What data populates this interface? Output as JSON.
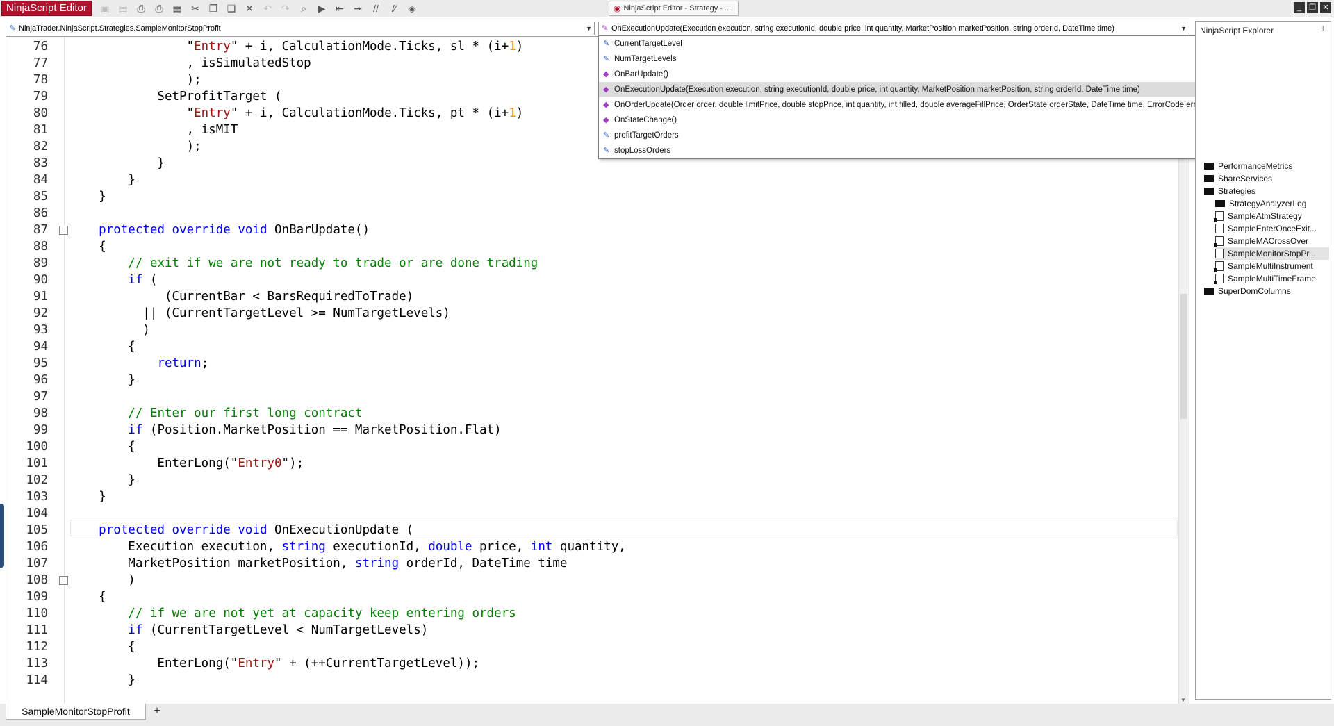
{
  "app": {
    "title": "NinjaScript Editor",
    "window_tab": "NinjaScript Editor - Strategy - ..."
  },
  "toolbar": [
    {
      "name": "save-icon",
      "glyph": "▣",
      "dim": true
    },
    {
      "name": "save-all-icon",
      "glyph": "▤",
      "dim": true
    },
    {
      "name": "print-icon",
      "glyph": "⎙",
      "dim": false
    },
    {
      "name": "print-preview-icon",
      "glyph": "⎙",
      "dim": false
    },
    {
      "name": "page-setup-icon",
      "glyph": "▦",
      "dim": false
    },
    {
      "name": "cut-icon",
      "glyph": "✂",
      "dim": false
    },
    {
      "name": "copy-icon",
      "glyph": "❐",
      "dim": false
    },
    {
      "name": "paste-icon",
      "glyph": "❏",
      "dim": false
    },
    {
      "name": "delete-icon",
      "glyph": "✕",
      "dim": false
    },
    {
      "name": "undo-icon",
      "glyph": "↶",
      "dim": true
    },
    {
      "name": "redo-icon",
      "glyph": "↷",
      "dim": true
    },
    {
      "name": "find-icon",
      "glyph": "⌕",
      "dim": false
    },
    {
      "name": "compile-icon",
      "glyph": "▶",
      "dim": false
    },
    {
      "name": "outdent-icon",
      "glyph": "⇤",
      "dim": false
    },
    {
      "name": "indent-icon",
      "glyph": "⇥",
      "dim": false
    },
    {
      "name": "comment-icon",
      "glyph": "//",
      "dim": false
    },
    {
      "name": "uncomment-icon",
      "glyph": "/⁄",
      "dim": false
    },
    {
      "name": "visual-studio-icon",
      "glyph": "◈",
      "dim": false
    }
  ],
  "class_dropdown": "NinjaTrader.NinjaScript.Strategies.SampleMonitorStopProfit",
  "member_dropdown": "OnExecutionUpdate(Execution execution, string executionId, double price, int quantity, MarketPosition marketPosition, string orderId, DateTime time)",
  "autocomplete": [
    {
      "label": "CurrentTargetLevel",
      "kind": "property",
      "selected": false
    },
    {
      "label": "NumTargetLevels",
      "kind": "property",
      "selected": false
    },
    {
      "label": "OnBarUpdate()",
      "kind": "method",
      "selected": false
    },
    {
      "label": "OnExecutionUpdate(Execution execution, string executionId, double price, int quantity, MarketPosition marketPosition, string orderId, DateTime time)",
      "kind": "method",
      "selected": true
    },
    {
      "label": "OnOrderUpdate(Order order, double limitPrice, double stopPrice, int quantity, int filled, double averageFillPrice, OrderState orderState, DateTime time, ErrorCode error, string nativeError)",
      "kind": "method",
      "selected": false
    },
    {
      "label": "OnStateChange()",
      "kind": "method",
      "selected": false
    },
    {
      "label": "profitTargetOrders",
      "kind": "property",
      "selected": false
    },
    {
      "label": "stopLossOrders",
      "kind": "property",
      "selected": false
    }
  ],
  "explorer": {
    "title": "NinjaScript Explorer",
    "items": [
      {
        "label": "PerformanceMetrics",
        "type": "folder",
        "indent": 0,
        "selected": false
      },
      {
        "label": "ShareServices",
        "type": "folder",
        "indent": 0,
        "selected": false
      },
      {
        "label": "Strategies",
        "type": "folder",
        "indent": 0,
        "selected": false
      },
      {
        "label": "StrategyAnalyzerLog",
        "type": "folder",
        "indent": 1,
        "selected": false
      },
      {
        "label": "SampleAtmStrategy",
        "type": "file-locked",
        "indent": 1,
        "selected": false
      },
      {
        "label": "SampleEnterOnceExit...",
        "type": "file",
        "indent": 1,
        "selected": false
      },
      {
        "label": "SampleMACrossOver",
        "type": "file-locked",
        "indent": 1,
        "selected": false
      },
      {
        "label": "SampleMonitorStopPr...",
        "type": "file",
        "indent": 1,
        "selected": true
      },
      {
        "label": "SampleMultiInstrument",
        "type": "file-locked",
        "indent": 1,
        "selected": false
      },
      {
        "label": "SampleMultiTimeFrame",
        "type": "file-locked",
        "indent": 1,
        "selected": false
      },
      {
        "label": "SuperDomColumns",
        "type": "folder",
        "indent": 0,
        "selected": false
      }
    ]
  },
  "code_lines": [
    {
      "n": "76",
      "t": [
        [
          "",
          "                \""
        ],
        [
          "str",
          "Entry"
        ],
        [
          "",
          "\" + i, CalculationMode.Ticks, sl * (i+"
        ],
        [
          "num",
          "1"
        ],
        [
          "",
          ")"
        ]
      ]
    },
    {
      "n": "77",
      "t": [
        [
          "",
          "                , isSimulatedStop"
        ]
      ]
    },
    {
      "n": "78",
      "t": [
        [
          "",
          "                );"
        ]
      ]
    },
    {
      "n": "79",
      "t": [
        [
          "",
          "            SetProfitTarget ("
        ]
      ]
    },
    {
      "n": "80",
      "t": [
        [
          "",
          "                \""
        ],
        [
          "str",
          "Entry"
        ],
        [
          "",
          "\" + i, CalculationMode.Ticks, pt * (i+"
        ],
        [
          "num",
          "1"
        ],
        [
          "",
          ")"
        ]
      ]
    },
    {
      "n": "81",
      "t": [
        [
          "",
          "                , isMIT"
        ]
      ]
    },
    {
      "n": "82",
      "t": [
        [
          "",
          "                );"
        ]
      ]
    },
    {
      "n": "83",
      "t": [
        [
          "",
          "            }"
        ]
      ]
    },
    {
      "n": "84",
      "t": [
        [
          "",
          "        }"
        ]
      ]
    },
    {
      "n": "85",
      "t": [
        [
          "",
          "    }"
        ]
      ]
    },
    {
      "n": "86",
      "t": [
        [
          "",
          ""
        ]
      ]
    },
    {
      "n": "87",
      "t": [
        [
          "",
          "    "
        ],
        [
          "kw",
          "protected"
        ],
        [
          "kw",
          " override"
        ],
        [
          "kw",
          " void"
        ],
        [
          "",
          " OnBarUpdate()"
        ]
      ]
    },
    {
      "n": "88",
      "t": [
        [
          "",
          "    {"
        ]
      ]
    },
    {
      "n": "89",
      "t": [
        [
          "",
          "        "
        ],
        [
          "cmt",
          "// exit if we are not ready to trade or are done trading"
        ]
      ]
    },
    {
      "n": "90",
      "t": [
        [
          "",
          "        "
        ],
        [
          "kw",
          "if"
        ],
        [
          "",
          " ("
        ]
      ]
    },
    {
      "n": "91",
      "t": [
        [
          "",
          "             (CurrentBar < BarsRequiredToTrade)"
        ]
      ]
    },
    {
      "n": "92",
      "t": [
        [
          "",
          "          || (CurrentTargetLevel >= NumTargetLevels)"
        ]
      ]
    },
    {
      "n": "93",
      "t": [
        [
          "",
          "          )"
        ]
      ]
    },
    {
      "n": "94",
      "t": [
        [
          "",
          "        {"
        ]
      ]
    },
    {
      "n": "95",
      "t": [
        [
          "",
          "            "
        ],
        [
          "kw",
          "return"
        ],
        [
          "",
          ";"
        ]
      ]
    },
    {
      "n": "96",
      "t": [
        [
          "",
          "        }"
        ]
      ]
    },
    {
      "n": "97",
      "t": [
        [
          "",
          ""
        ]
      ]
    },
    {
      "n": "98",
      "t": [
        [
          "",
          "        "
        ],
        [
          "cmt",
          "// Enter our first long contract"
        ]
      ]
    },
    {
      "n": "99",
      "t": [
        [
          "",
          "        "
        ],
        [
          "kw",
          "if"
        ],
        [
          "",
          " (Position.MarketPosition == MarketPosition.Flat)"
        ]
      ]
    },
    {
      "n": "100",
      "t": [
        [
          "",
          "        {"
        ]
      ]
    },
    {
      "n": "101",
      "t": [
        [
          "",
          "            EnterLong(\""
        ],
        [
          "str",
          "Entry0"
        ],
        [
          "",
          "\");"
        ]
      ]
    },
    {
      "n": "102",
      "t": [
        [
          "",
          "        }"
        ]
      ]
    },
    {
      "n": "103",
      "t": [
        [
          "",
          "    }"
        ]
      ]
    },
    {
      "n": "104",
      "t": [
        [
          "",
          ""
        ]
      ]
    },
    {
      "n": "105",
      "t": [
        [
          "",
          "    "
        ],
        [
          "kw",
          "protected"
        ],
        [
          "kw",
          " override"
        ],
        [
          "kw",
          " void"
        ],
        [
          "",
          " OnExecutionUpdate ("
        ]
      ]
    },
    {
      "n": "106",
      "t": [
        [
          "",
          "        Execution execution, "
        ],
        [
          "kw",
          "string"
        ],
        [
          "",
          " executionId, "
        ],
        [
          "kw",
          "double"
        ],
        [
          "",
          " price, "
        ],
        [
          "kw",
          "int"
        ],
        [
          "",
          " quantity,"
        ]
      ]
    },
    {
      "n": "107",
      "t": [
        [
          "",
          "        MarketPosition marketPosition, "
        ],
        [
          "kw",
          "string"
        ],
        [
          "",
          " orderId, DateTime time"
        ]
      ]
    },
    {
      "n": "108",
      "t": [
        [
          "",
          "        )"
        ]
      ]
    },
    {
      "n": "109",
      "t": [
        [
          "",
          "    {"
        ]
      ]
    },
    {
      "n": "110",
      "t": [
        [
          "",
          "        "
        ],
        [
          "cmt",
          "// if we are not yet at capacity keep entering orders"
        ]
      ]
    },
    {
      "n": "111",
      "t": [
        [
          "",
          "        "
        ],
        [
          "kw",
          "if"
        ],
        [
          "",
          " (CurrentTargetLevel < NumTargetLevels)"
        ]
      ]
    },
    {
      "n": "112",
      "t": [
        [
          "",
          "        {"
        ]
      ]
    },
    {
      "n": "113",
      "t": [
        [
          "",
          "            EnterLong(\""
        ],
        [
          "str",
          "Entry"
        ],
        [
          "",
          "\" + (++CurrentTargetLevel));"
        ]
      ]
    },
    {
      "n": "114",
      "t": [
        [
          "",
          "        }"
        ]
      ]
    }
  ],
  "fold_markers": [
    "87",
    "108"
  ],
  "bottom_tab": "SampleMonitorStopProfit",
  "add_tab": "+"
}
